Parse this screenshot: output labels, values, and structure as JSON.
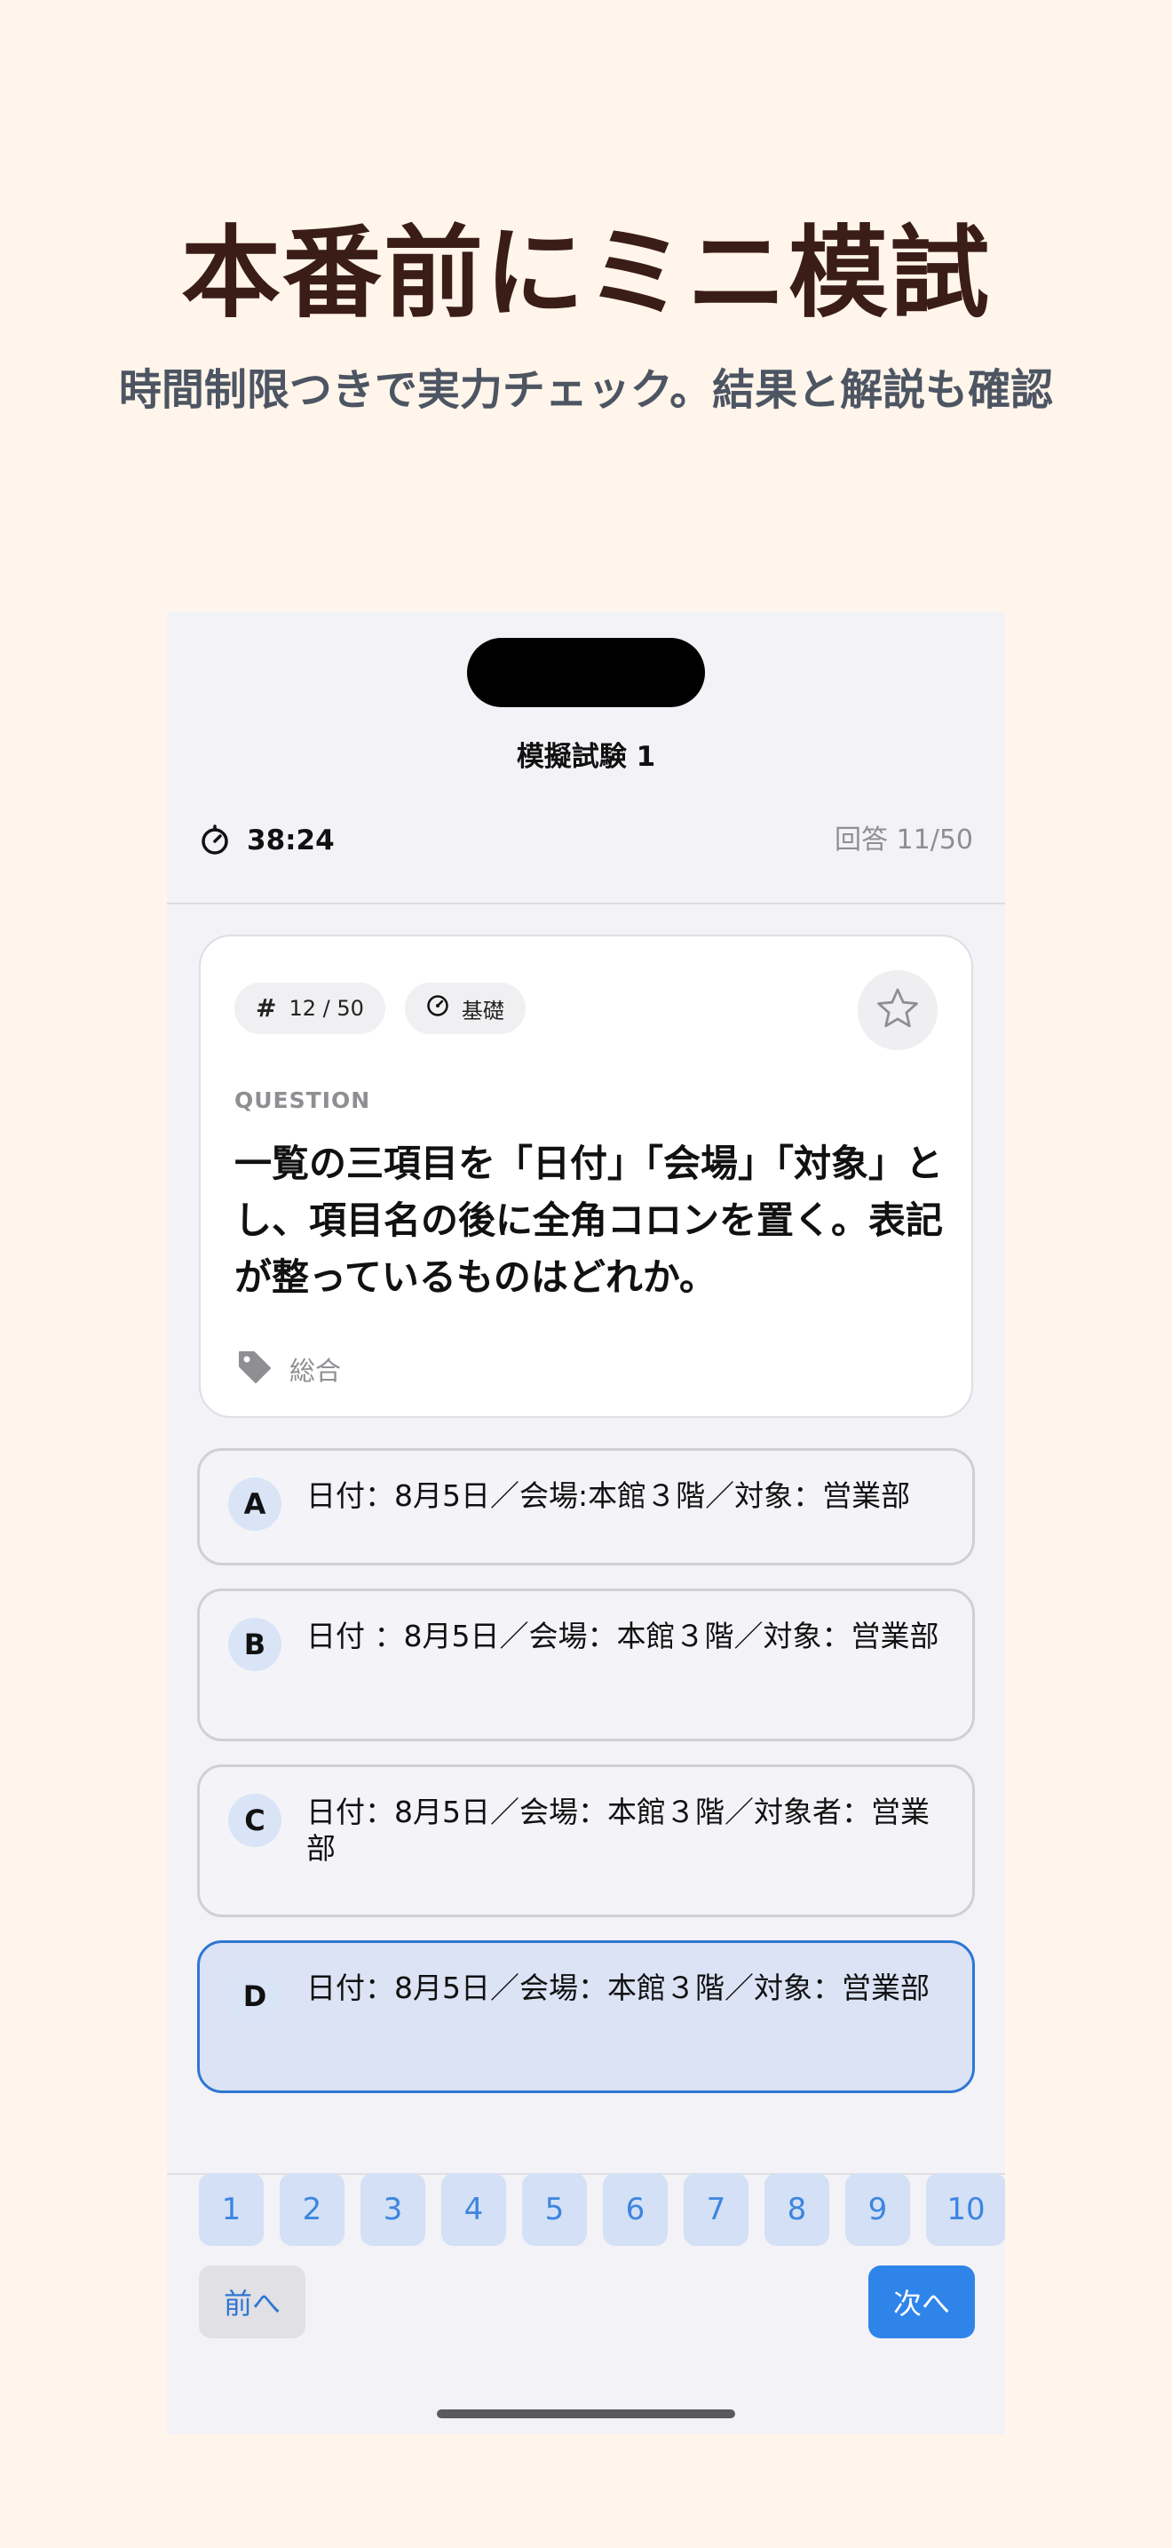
{
  "promo": {
    "headline": "本番前にミニ模試",
    "subhead": "時間制限つきで実力チェック。結果と解説も確認"
  },
  "screen": {
    "title": "模擬試験 1",
    "timer": "38:24",
    "progress": "回答 11/50"
  },
  "question": {
    "number_chip": "12 / 50",
    "level_chip": "基礎",
    "label": "QUESTION",
    "text": "一覧の三項目を「日付」「会場」「対象」とし、項目名の後に全角コロンを置く。表記が整っているものはどれか。",
    "tag": "総合",
    "bookmarked": false
  },
  "options": [
    {
      "letter": "A",
      "text": "日付：8月5日／会場:本館３階／対象：営業部",
      "selected": false
    },
    {
      "letter": "B",
      "text": "日付 ：8月5日／会場：本館３階／対象：営業部",
      "selected": false
    },
    {
      "letter": "C",
      "text": "日付：8月5日／会場：本館３階／対象者：営業部",
      "selected": false
    },
    {
      "letter": "D",
      "text": "日付：8月5日／会場：本館３階／対象：営業部",
      "selected": true
    }
  ],
  "pager": [
    "1",
    "2",
    "3",
    "4",
    "5",
    "6",
    "7",
    "8",
    "9",
    "10"
  ],
  "nav": {
    "prev_label": "前へ",
    "next_label": "次へ"
  },
  "colors": {
    "accent": "#2f84ea",
    "selected_border": "#2f76d2",
    "selected_fill": "#dbe3f5",
    "headline": "#3b1d17",
    "background": "#fff5ea"
  }
}
